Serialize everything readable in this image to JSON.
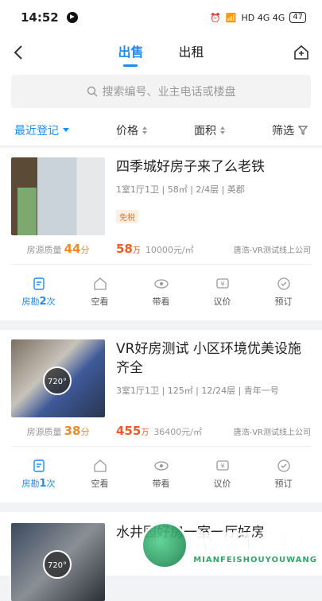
{
  "status": {
    "time": "14:52",
    "network": "HD 4G 4G",
    "battery": "47"
  },
  "nav": {
    "tabs": [
      "出售",
      "出租"
    ],
    "active_tab": "出售"
  },
  "search": {
    "placeholder": "搜索编号、业主电话或楼盘"
  },
  "filters": [
    {
      "label": "最近登记",
      "active": true
    },
    {
      "label": "价格"
    },
    {
      "label": "面积"
    },
    {
      "label": "筛选"
    }
  ],
  "listings": [
    {
      "title": "四季城好房子来了么老铁",
      "meta": "1室1厅1卫 | 58㎡ | 2/4层 | 英郡",
      "tag": "免税",
      "quality_label": "房源质量",
      "quality": "44",
      "quality_unit": "分",
      "price": "58",
      "price_unit": "万",
      "unit_price": "10000元/㎡",
      "agent": "唐浩-VR测试线上公司",
      "actions": [
        {
          "label": "房勘",
          "count": "2",
          "suffix": "次"
        },
        {
          "label": "空看"
        },
        {
          "label": "带看"
        },
        {
          "label": "议价"
        },
        {
          "label": "预订"
        }
      ]
    },
    {
      "title": "VR好房测试  小区环境优美设施齐全",
      "meta": "3室1厅1卫 | 125㎡ | 12/24层 | 青年一号",
      "vr_badge": "720°",
      "quality_label": "房源质量",
      "quality": "38",
      "quality_unit": "分",
      "price": "455",
      "price_unit": "万",
      "unit_price": "36400元/㎡",
      "agent": "唐浩-VR测试线上公司",
      "actions": [
        {
          "label": "房勘",
          "count": "1",
          "suffix": "次"
        },
        {
          "label": "空看"
        },
        {
          "label": "带看"
        },
        {
          "label": "议价"
        },
        {
          "label": "预订"
        }
      ]
    },
    {
      "title": "水井园好房一室一厅好房",
      "vr_badge": "720°"
    }
  ],
  "watermark": {
    "cn": "免费手游网",
    "en": "MIANFEISHOUYOUWANG"
  },
  "colors": {
    "accent": "#1f8bef",
    "price": "#f1592a",
    "score": "#ee8a26"
  }
}
